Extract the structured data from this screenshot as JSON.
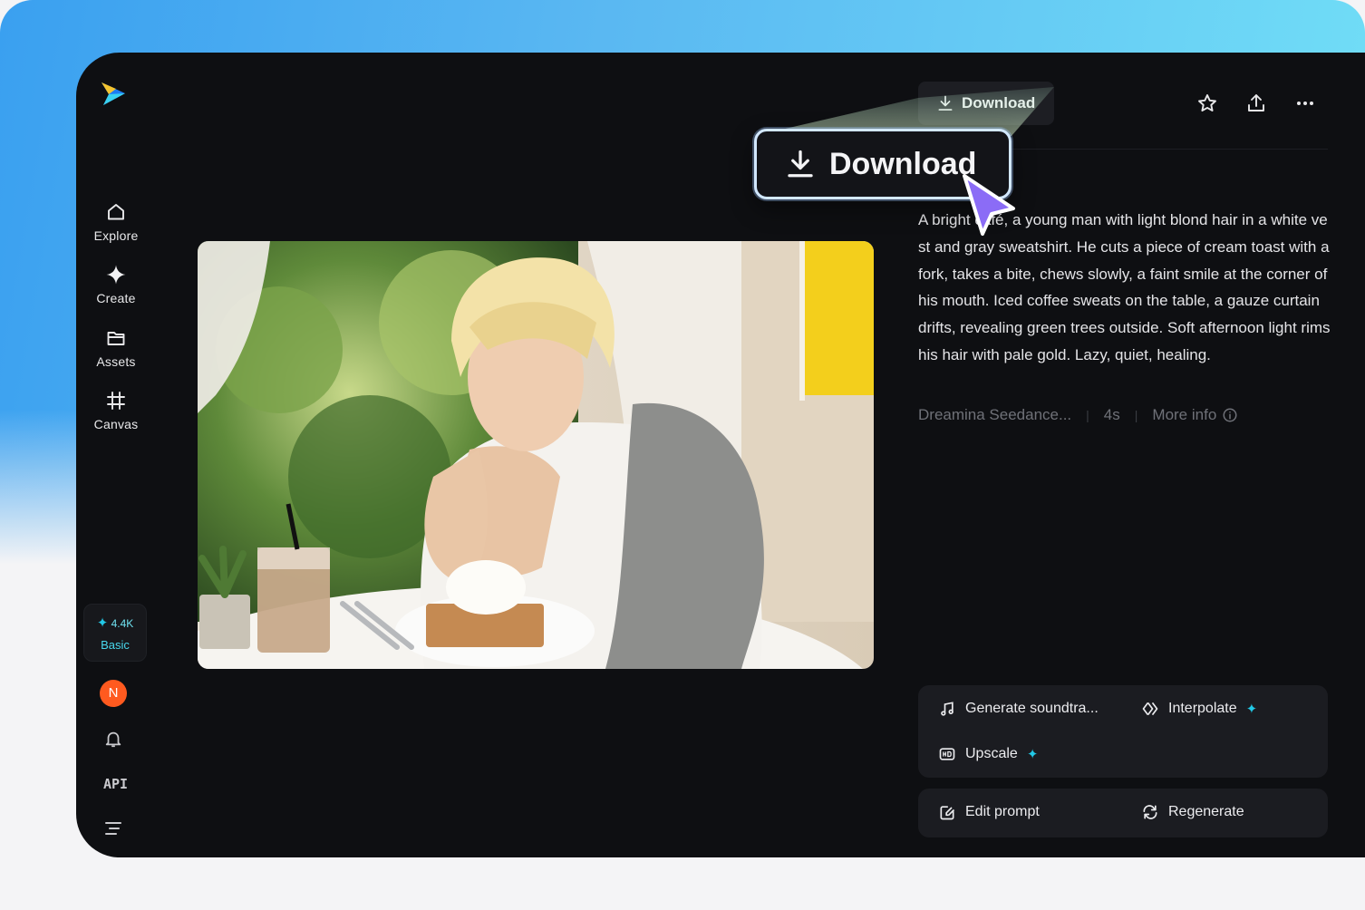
{
  "sidebar": {
    "items": [
      {
        "label": "Explore",
        "icon": "home-icon"
      },
      {
        "label": "Create",
        "icon": "sparkle-icon"
      },
      {
        "label": "Assets",
        "icon": "folder-icon"
      },
      {
        "label": "Canvas",
        "icon": "canvas-icon"
      }
    ],
    "credits": {
      "amount": "4.4K",
      "plan": "Basic"
    },
    "avatar_initial": "N",
    "api_label": "API"
  },
  "header": {
    "download_label": "Download",
    "icons": [
      "star-icon",
      "share-icon",
      "more-icon"
    ]
  },
  "callout": {
    "download_label": "Download"
  },
  "description": "A bright café, a young man with light blond hair in a white vest and gray sweatshirt. He cuts a piece of cream toast with a fork, takes a bite, chews slowly, a faint smile at the corner of his mouth. Iced coffee sweats on the table, a gauze curtain drifts, revealing green trees outside. Soft afternoon light rims his hair with pale gold. Lazy, quiet, healing.",
  "meta": {
    "model": "Dreamina Seedance...",
    "duration": "4s",
    "more_info": "More info"
  },
  "actions": {
    "generate_soundtrack": "Generate soundtra...",
    "interpolate": "Interpolate",
    "upscale": "Upscale",
    "edit_prompt": "Edit prompt",
    "regenerate": "Regenerate"
  },
  "colors": {
    "accent": "#22c8e6",
    "avatar": "#ff5a1f",
    "cursor": "#8b6cf6",
    "app_bg": "#0e0f12"
  }
}
